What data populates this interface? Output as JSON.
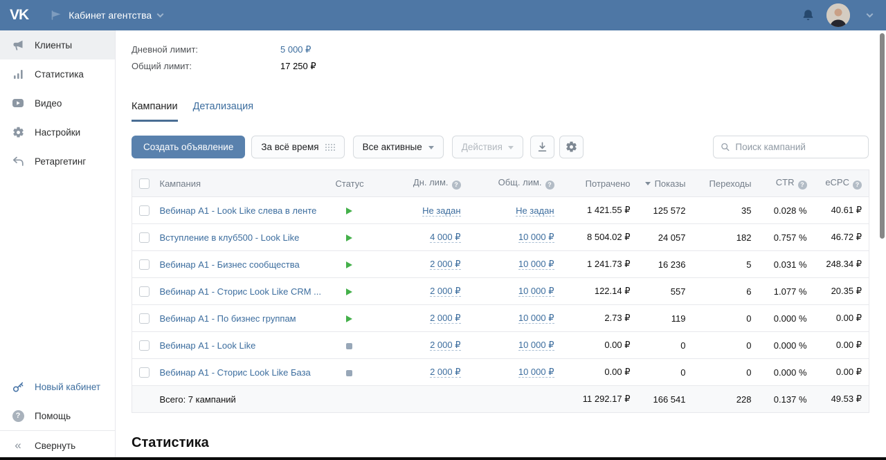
{
  "topbar": {
    "logo": "VK",
    "cabinet_title": "Кабинет агентства"
  },
  "sidebar": {
    "items": [
      {
        "label": "Клиенты",
        "icon": "megaphone-icon",
        "active": true
      },
      {
        "label": "Статистика",
        "icon": "bar-chart-icon",
        "active": false
      },
      {
        "label": "Видео",
        "icon": "video-icon",
        "active": false
      },
      {
        "label": "Настройки",
        "icon": "gear-icon",
        "active": false
      },
      {
        "label": "Ретаргетинг",
        "icon": "retargeting-icon",
        "active": false
      }
    ],
    "new_cabinet": "Новый кабинет",
    "help": "Помощь",
    "collapse": "Свернуть"
  },
  "limits": {
    "daily_label": "Дневной лимит:",
    "daily_value": "5 000 ₽",
    "total_label": "Общий лимит:",
    "total_value": "17 250 ₽"
  },
  "tabs": {
    "campaigns": "Кампании",
    "details": "Детализация"
  },
  "toolbar": {
    "create_button": "Создать объявление",
    "period_button": "За всё время",
    "filter_button": "Все активные",
    "actions_button": "Действия",
    "search_placeholder": "Поиск кампаний"
  },
  "table": {
    "headers": {
      "campaign": "Кампания",
      "status": "Статус",
      "daily_limit": "Дн. лим.",
      "total_limit": "Общ. лим.",
      "spent": "Потрачено",
      "impressions": "Показы",
      "clicks": "Переходы",
      "ctr": "CTR",
      "ecpc": "eCPC"
    },
    "rows": [
      {
        "name": "Вебинар А1 - Look Like слева в ленте",
        "status": "active",
        "daily_limit": "Не задан",
        "total_limit": "Не задан",
        "spent": "1 421.55 ₽",
        "impressions": "125 572",
        "clicks": "35",
        "ctr": "0.028 %",
        "ecpc": "40.61 ₽"
      },
      {
        "name": "Вступление в клуб500 - Look Like",
        "status": "active",
        "daily_limit": "4 000 ₽",
        "total_limit": "10 000 ₽",
        "spent": "8 504.02 ₽",
        "impressions": "24 057",
        "clicks": "182",
        "ctr": "0.757 %",
        "ecpc": "46.72 ₽"
      },
      {
        "name": "Вебинар А1 - Бизнес сообщества",
        "status": "active",
        "daily_limit": "2 000 ₽",
        "total_limit": "10 000 ₽",
        "spent": "1 241.73 ₽",
        "impressions": "16 236",
        "clicks": "5",
        "ctr": "0.031 %",
        "ecpc": "248.34 ₽"
      },
      {
        "name": "Вебинар А1 - Сторис Look Like CRM ...",
        "status": "active",
        "daily_limit": "2 000 ₽",
        "total_limit": "10 000 ₽",
        "spent": "122.14 ₽",
        "impressions": "557",
        "clicks": "6",
        "ctr": "1.077 %",
        "ecpc": "20.35 ₽"
      },
      {
        "name": "Вебинар А1 - По бизнес группам",
        "status": "active",
        "daily_limit": "2 000 ₽",
        "total_limit": "10 000 ₽",
        "spent": "2.73 ₽",
        "impressions": "119",
        "clicks": "0",
        "ctr": "0.000 %",
        "ecpc": "0.00 ₽"
      },
      {
        "name": "Вебинар А1 - Look Like",
        "status": "stopped",
        "daily_limit": "2 000 ₽",
        "total_limit": "10 000 ₽",
        "spent": "0.00 ₽",
        "impressions": "0",
        "clicks": "0",
        "ctr": "0.000 %",
        "ecpc": "0.00 ₽"
      },
      {
        "name": "Вебинар А1 - Сторис Look Like База",
        "status": "stopped",
        "daily_limit": "2 000 ₽",
        "total_limit": "10 000 ₽",
        "spent": "0.00 ₽",
        "impressions": "0",
        "clicks": "0",
        "ctr": "0.000 %",
        "ecpc": "0.00 ₽"
      }
    ],
    "totals": {
      "label": "Всего: 7 кампаний",
      "spent": "11 292.17 ₽",
      "impressions": "166 541",
      "clicks": "228",
      "ctr": "0.137 %",
      "ecpc": "49.53 ₽"
    }
  },
  "stats_section_title": "Статистика",
  "colors": {
    "topbar": "#4e77a5",
    "link": "#3c6d9e",
    "primary_button": "#5981ad",
    "status_active": "#44b04a",
    "status_stopped": "#98a7b8",
    "table_header_bg": "#f6f7f9"
  }
}
